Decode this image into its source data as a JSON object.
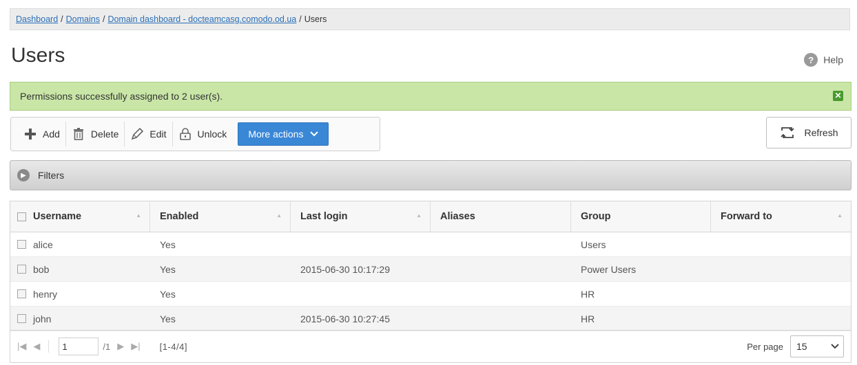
{
  "breadcrumb": {
    "items": [
      "Dashboard",
      "Domains",
      "Domain dashboard - docteamcasg.comodo.od.ua"
    ],
    "current": "Users",
    "separator": "/"
  },
  "page": {
    "title": "Users",
    "help_label": "Help",
    "help_icon": "?"
  },
  "alert": {
    "message": "Permissions successfully assigned to 2 user(s).",
    "close_icon": "✕"
  },
  "toolbar": {
    "add_label": "Add",
    "delete_label": "Delete",
    "edit_label": "Edit",
    "unlock_label": "Unlock",
    "more_actions_label": "More actions"
  },
  "refresh": {
    "label": "Refresh"
  },
  "filters": {
    "label": "Filters"
  },
  "table": {
    "columns": [
      "Username",
      "Enabled",
      "Last login",
      "Aliases",
      "Group",
      "Forward to"
    ],
    "rows": [
      {
        "username": "alice",
        "enabled": "Yes",
        "last_login": "",
        "aliases": "",
        "group": "Users",
        "forward_to": ""
      },
      {
        "username": "bob",
        "enabled": "Yes",
        "last_login": "2015-06-30 10:17:29",
        "aliases": "",
        "group": "Power Users",
        "forward_to": ""
      },
      {
        "username": "henry",
        "enabled": "Yes",
        "last_login": "",
        "aliases": "",
        "group": "HR",
        "forward_to": ""
      },
      {
        "username": "john",
        "enabled": "Yes",
        "last_login": "2015-06-30 10:27:45",
        "aliases": "",
        "group": "HR",
        "forward_to": ""
      }
    ]
  },
  "pager": {
    "page": "1",
    "total": "/1",
    "range": "[1-4/4]",
    "per_page_label": "Per page",
    "per_page": "15"
  },
  "colors": {
    "accent": "#3a87d6",
    "success_bg": "#c9e6a7",
    "link": "#2a6fb8"
  }
}
